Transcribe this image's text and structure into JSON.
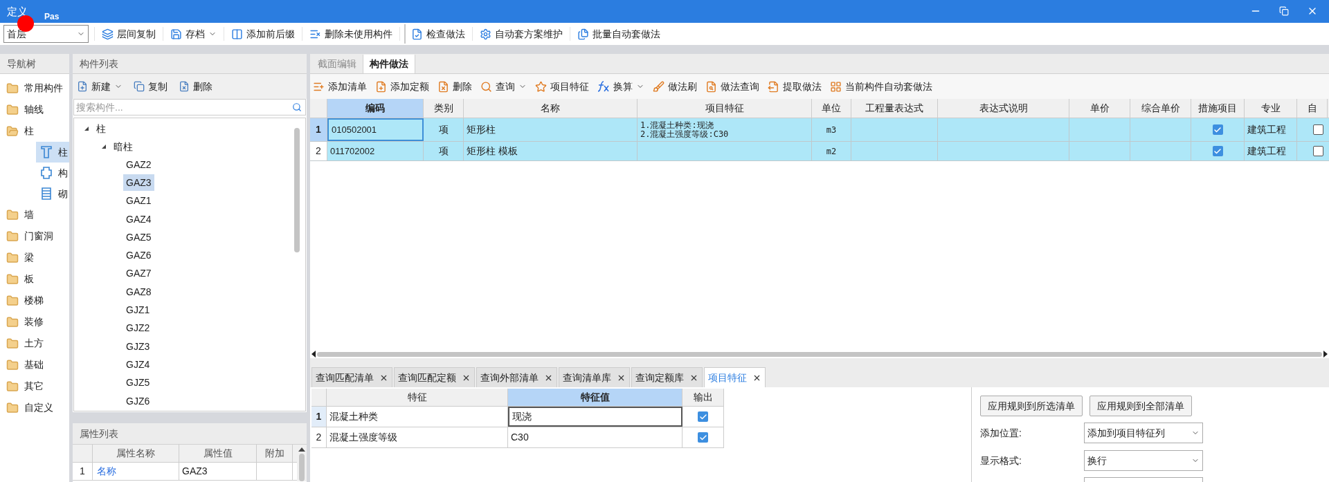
{
  "window": {
    "title": "定义",
    "caption": "Pas"
  },
  "toolbar": {
    "floor": "首层",
    "buttons": [
      {
        "label": "层间复制",
        "dropdown": false,
        "separator": false
      },
      {
        "label": "存档",
        "dropdown": true,
        "separator": false
      },
      {
        "label": "添加前后缀",
        "dropdown": false,
        "separator": false
      },
      {
        "label": "删除未使用构件",
        "dropdown": false,
        "separator": false
      },
      {
        "label": "检查做法",
        "dropdown": false,
        "separator": true
      },
      {
        "label": "自动套方案维护",
        "dropdown": false,
        "separator": false
      },
      {
        "label": "批量自动套做法",
        "dropdown": false,
        "separator": false
      }
    ]
  },
  "nav_tree": {
    "title": "导航树",
    "items": [
      {
        "label": "常用构件",
        "expanded": false
      },
      {
        "label": "轴线",
        "expanded": false
      },
      {
        "label": "柱",
        "expanded": true,
        "children": [
          {
            "label": "柱",
            "kind": "column",
            "selected": true
          },
          {
            "label": "构",
            "kind": "block",
            "selected": false
          },
          {
            "label": "砌",
            "kind": "masonry",
            "selected": false
          }
        ]
      },
      {
        "label": "墙",
        "expanded": false
      },
      {
        "label": "门窗洞",
        "expanded": false
      },
      {
        "label": "梁",
        "expanded": false
      },
      {
        "label": "板",
        "expanded": false
      },
      {
        "label": "楼梯",
        "expanded": false
      },
      {
        "label": "装修",
        "expanded": false
      },
      {
        "label": "土方",
        "expanded": false
      },
      {
        "label": "基础",
        "expanded": false
      },
      {
        "label": "其它",
        "expanded": false
      },
      {
        "label": "自定义",
        "expanded": false
      }
    ]
  },
  "component_list": {
    "title": "构件列表",
    "buttons": [
      {
        "label": "新建",
        "dropdown": true
      },
      {
        "label": "复制",
        "dropdown": false
      },
      {
        "label": "删除",
        "dropdown": false
      }
    ],
    "search": {
      "placeholder": "搜索构件..."
    },
    "tree": [
      {
        "label": "柱",
        "expanded": true,
        "children": [
          {
            "label": "暗柱",
            "expanded": true,
            "children": [
              {
                "label": "GAZ2",
                "selected": false
              },
              {
                "label": "GAZ3",
                "selected": true
              },
              {
                "label": "GAZ1",
                "selected": false
              },
              {
                "label": "GAZ4",
                "selected": false
              },
              {
                "label": "GAZ5",
                "selected": false
              },
              {
                "label": "GAZ6",
                "selected": false
              },
              {
                "label": "GAZ7",
                "selected": false
              },
              {
                "label": "GAZ8",
                "selected": false
              },
              {
                "label": "GJZ1",
                "selected": false
              },
              {
                "label": "GJZ2",
                "selected": false
              },
              {
                "label": "GJZ3",
                "selected": false
              },
              {
                "label": "GJZ4",
                "selected": false
              },
              {
                "label": "GJZ5",
                "selected": false
              },
              {
                "label": "GJZ6",
                "selected": false
              }
            ]
          }
        ]
      }
    ]
  },
  "properties": {
    "title": "属性列表",
    "columns": [
      "属性名称",
      "属性值",
      "附加"
    ],
    "rows": [
      {
        "index": "1",
        "name": "名称",
        "value": "GAZ3"
      }
    ]
  },
  "main": {
    "tabs": [
      {
        "label": "截面编辑",
        "selected": false
      },
      {
        "label": "构件做法",
        "selected": true
      }
    ],
    "toolbar": [
      {
        "label": "添加清单",
        "dropdown": false
      },
      {
        "label": "添加定额",
        "dropdown": false
      },
      {
        "label": "删除",
        "dropdown": false
      },
      {
        "label": "查询",
        "dropdown": true
      },
      {
        "label": "项目特征",
        "dropdown": false
      },
      {
        "label": "换算",
        "dropdown": true
      },
      {
        "label": "做法刷",
        "dropdown": false
      },
      {
        "label": "做法查询",
        "dropdown": false
      },
      {
        "label": "提取做法",
        "dropdown": false
      },
      {
        "label": "当前构件自动套做法",
        "dropdown": false
      }
    ],
    "table": {
      "columns": [
        {
          "label": "编码",
          "selected": true
        },
        {
          "label": "类别",
          "selected": false
        },
        {
          "label": "名称",
          "selected": false
        },
        {
          "label": "项目特征",
          "selected": false
        },
        {
          "label": "单位",
          "selected": false
        },
        {
          "label": "工程量表达式",
          "selected": false
        },
        {
          "label": "表达式说明",
          "selected": false
        },
        {
          "label": "单价",
          "selected": false
        },
        {
          "label": "综合单价",
          "selected": false
        },
        {
          "label": "措施项目",
          "selected": false
        },
        {
          "label": "专业",
          "selected": false
        },
        {
          "label": "自",
          "selected": false
        }
      ],
      "rows": [
        {
          "index": "1",
          "selected": true,
          "code": "010502001",
          "type": "项",
          "name": "矩形柱",
          "features": [
            "1.混凝土种类:现浇",
            "2.混凝土强度等级:C30"
          ],
          "unit": "m3",
          "measure": true,
          "discipline": "建筑工程",
          "auto": false
        },
        {
          "index": "2",
          "selected": false,
          "code": "011702002",
          "type": "项",
          "name": "矩形柱 模板",
          "unit": "m2",
          "measure": true,
          "discipline": "建筑工程",
          "auto": false
        }
      ]
    }
  },
  "bottom": {
    "tabs": [
      {
        "label": "查询匹配清单",
        "selected": false
      },
      {
        "label": "查询匹配定额",
        "selected": false
      },
      {
        "label": "查询外部清单",
        "selected": false
      },
      {
        "label": "查询清单库",
        "selected": false
      },
      {
        "label": "查询定额库",
        "selected": false
      },
      {
        "label": "项目特征",
        "selected": true
      }
    ],
    "grid": {
      "columns": [
        {
          "label": "特征",
          "selected": false
        },
        {
          "label": "特征值",
          "selected": true
        },
        {
          "label": "输出",
          "selected": false
        }
      ],
      "rows": [
        {
          "index": "1",
          "selected": true,
          "feature": "混凝土种类",
          "value": "现浇",
          "output": true
        },
        {
          "index": "2",
          "selected": false,
          "feature": "混凝土强度等级",
          "value": "C30",
          "output": true
        }
      ]
    },
    "actions": [
      "应用规则到所选清单",
      "应用规则到全部清单"
    ],
    "fields": [
      {
        "label": "添加位置:",
        "value": "添加到项目特征列"
      },
      {
        "label": "显示格式:",
        "value": "换行"
      }
    ]
  }
}
